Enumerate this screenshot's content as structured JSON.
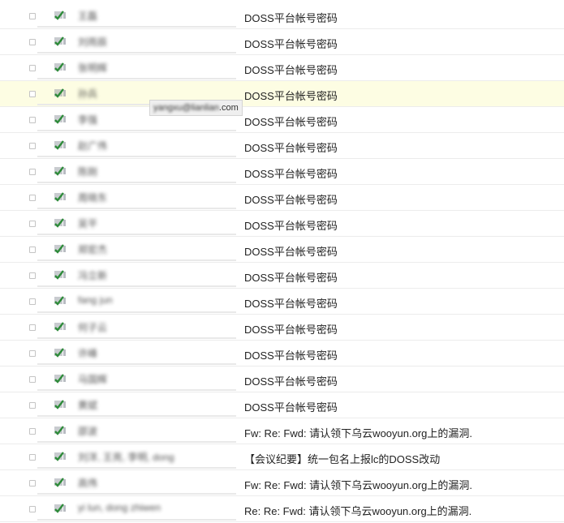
{
  "emails": [
    {
      "sender": "王磊",
      "subject": "DOSS平台帐号密码",
      "highlighted": false
    },
    {
      "sender": "刘雨辰",
      "subject": "DOSS平台帐号密码",
      "highlighted": false
    },
    {
      "sender": "张明辉",
      "subject": "DOSS平台帐号密码",
      "highlighted": false
    },
    {
      "sender": "孙兵",
      "subject": "DOSS平台帐号密码",
      "highlighted": true
    },
    {
      "sender": "李强",
      "subject": "DOSS平台帐号密码",
      "highlighted": false
    },
    {
      "sender": "赵广伟",
      "subject": "DOSS平台帐号密码",
      "highlighted": false
    },
    {
      "sender": "陈刚",
      "subject": "DOSS平台帐号密码",
      "highlighted": false
    },
    {
      "sender": "周晓东",
      "subject": "DOSS平台帐号密码",
      "highlighted": false
    },
    {
      "sender": "吴平",
      "subject": "DOSS平台帐号密码",
      "highlighted": false
    },
    {
      "sender": "郑宏杰",
      "subject": "DOSS平台帐号密码",
      "highlighted": false
    },
    {
      "sender": "冯立新",
      "subject": "DOSS平台帐号密码",
      "highlighted": false
    },
    {
      "sender": "fang jun",
      "subject": "DOSS平台帐号密码",
      "highlighted": false
    },
    {
      "sender": "何子云",
      "subject": "DOSS平台帐号密码",
      "highlighted": false
    },
    {
      "sender": "许峰",
      "subject": "DOSS平台帐号密码",
      "highlighted": false
    },
    {
      "sender": "马国辉",
      "subject": "DOSS平台帐号密码",
      "highlighted": false
    },
    {
      "sender": "黄斌",
      "subject": "DOSS平台帐号密码",
      "highlighted": false
    },
    {
      "sender": "邵波",
      "subject": "Fw: Re: Fwd: 请认领下乌云wooyun.org上的漏洞.",
      "highlighted": false
    },
    {
      "sender": "刘洋, 王亮, 李明, dong",
      "subject": "【会议纪要】统一包名上报lc的DOSS改动",
      "highlighted": false
    },
    {
      "sender": "高伟",
      "subject": "Fw: Re: Fwd: 请认领下乌云wooyun.org上的漏洞.",
      "highlighted": false
    },
    {
      "sender": "yi lun, dong zhiwen",
      "subject": "Re: Re: Fwd: 请认领下乌云wooyun.org上的漏洞.",
      "highlighted": false
    }
  ],
  "tooltip": {
    "blurred": "yangxu@lianlian",
    ".com": ".com"
  },
  "colors": {
    "highlight": "#fdfde3",
    "icon_green": "#2e8b3a",
    "icon_gray": "#9aa0a8"
  }
}
